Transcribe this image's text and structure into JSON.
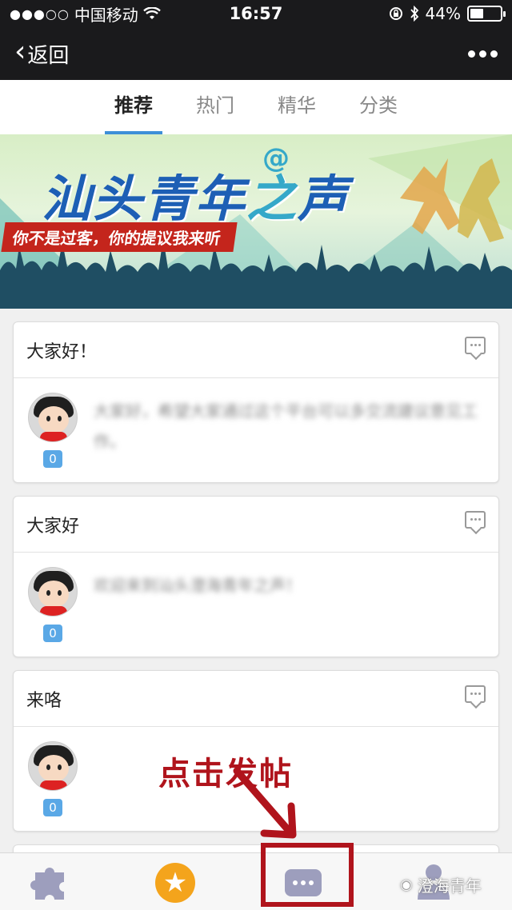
{
  "status_bar": {
    "carrier": "中国移动",
    "time": "16:57",
    "battery": "44%",
    "battery_level": 0.44
  },
  "nav": {
    "back_label": "返回"
  },
  "tabs": [
    {
      "label": "推荐",
      "active": true
    },
    {
      "label": "热门",
      "active": false
    },
    {
      "label": "精华",
      "active": false
    },
    {
      "label": "分类",
      "active": false
    }
  ],
  "banner": {
    "title_a": "汕头青年",
    "title_b": "之",
    "title_c": "声",
    "at": "@",
    "slogan": "你不是过客，你的提议我来听"
  },
  "posts": [
    {
      "title": "大家好！",
      "snippet": "大家好，希望大家通过这个平台可以多交流建议意见工作。",
      "count": "0"
    },
    {
      "title": "大家好",
      "snippet": "欢迎来到汕头澄海青年之声！",
      "count": "0"
    },
    {
      "title": "来咯",
      "snippet": "",
      "count": "0"
    }
  ],
  "annotation": {
    "callout": "点击发帖"
  },
  "watermark": {
    "text": "澄海青年"
  },
  "colors": {
    "accent": "#3d8fd8",
    "highlight": "#b0141c",
    "badge": "#5aa8e6",
    "star": "#f4a41c"
  }
}
